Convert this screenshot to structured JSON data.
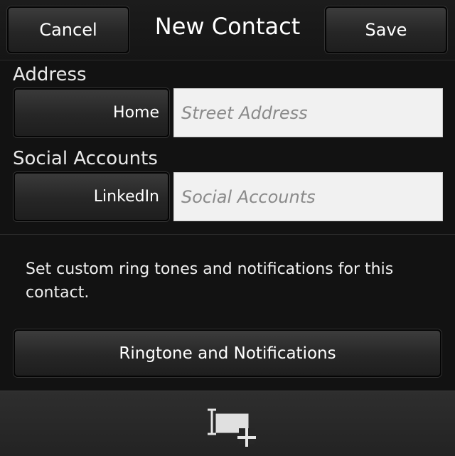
{
  "header": {
    "cancel_label": "Cancel",
    "title": "New Contact",
    "save_label": "Save"
  },
  "address": {
    "section_label": "Address",
    "type_label": "Home",
    "placeholder": "Street Address",
    "value": ""
  },
  "social": {
    "section_label": "Social Accounts",
    "type_label": "LinkedIn",
    "placeholder": "Social Accounts",
    "value": ""
  },
  "notifications": {
    "description": "Set custom ring tones and notifications for this contact.",
    "button_label": "Ringtone and Notifications"
  },
  "bottom_bar": {
    "icon": "add-field-icon"
  },
  "colors": {
    "background": "#121212",
    "field_background": "#f1f1f1",
    "button_gradient_top": "#3c3c3c",
    "button_gradient_bottom": "#1e1e1e"
  }
}
